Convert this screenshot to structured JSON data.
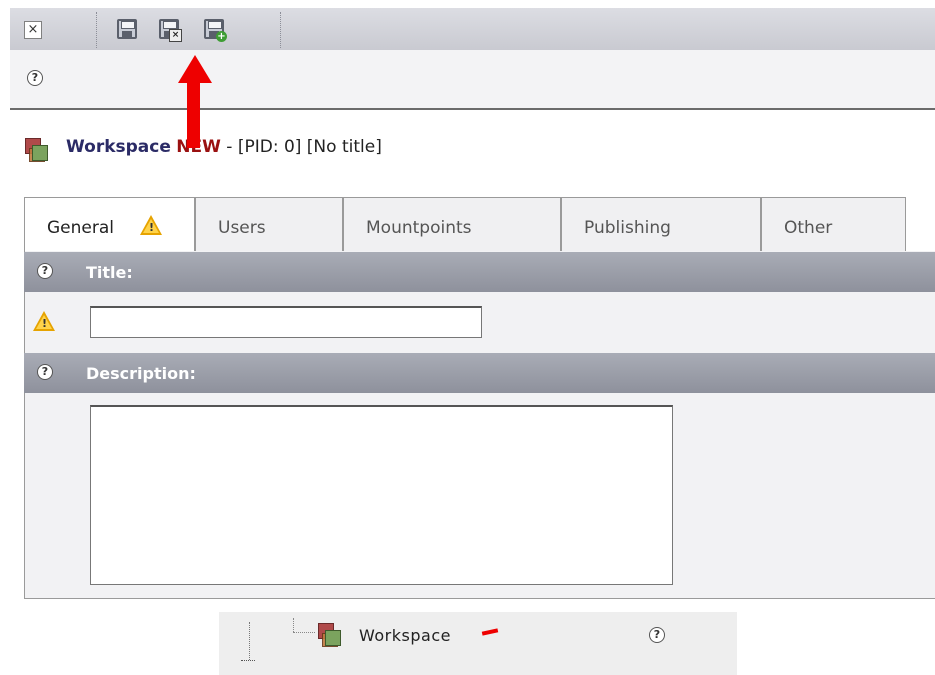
{
  "toolbar": {
    "close_icon": "close-icon",
    "save_icon": "save-icon",
    "save_close_icon": "save-and-close-icon",
    "save_new_icon": "save-and-new-icon"
  },
  "help_icon_glyph": "?",
  "header": {
    "title": "Workspace",
    "new_label": "NEW",
    "rest": " - [PID: 0] [No title]"
  },
  "tabs": [
    {
      "label": "General",
      "has_warning": true,
      "active": true
    },
    {
      "label": "Users"
    },
    {
      "label": "Mountpoints"
    },
    {
      "label": "Publishing"
    },
    {
      "label": "Other"
    }
  ],
  "fields": {
    "title": {
      "label": "Title:",
      "value": ""
    },
    "description": {
      "label": "Description:",
      "value": ""
    }
  },
  "tree": {
    "item_label": "Workspace"
  },
  "colors": {
    "annotation": "#ee0000",
    "header_title": "#2b2b66",
    "new_label": "#9a1010",
    "section_header": "#989ba6"
  }
}
